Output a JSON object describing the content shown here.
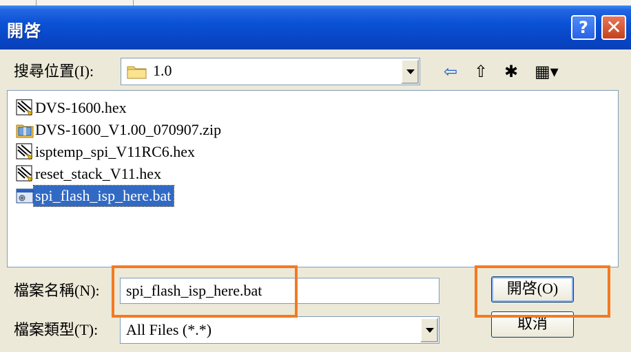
{
  "window": {
    "title": "開啓"
  },
  "titlebar": {
    "help_icon": "?",
    "close_icon": "✕"
  },
  "lookin": {
    "label": "搜尋位置(I):",
    "value": "1.0"
  },
  "toolbar": {
    "back_icon": "⇦",
    "up_icon": "⇧",
    "new_folder_icon": "✱",
    "view_icon": "▦▾"
  },
  "files": [
    {
      "name": "DVS-1600.hex",
      "icon": "hex-file-icon"
    },
    {
      "name": "DVS-1600_V1.00_070907.zip",
      "icon": "zip-file-icon"
    },
    {
      "name": "isptemp_spi_V11RC6.hex",
      "icon": "hex-file-icon"
    },
    {
      "name": "reset_stack_V11.hex",
      "icon": "hex-file-icon"
    },
    {
      "name": "spi_flash_isp_here.bat",
      "icon": "bat-file-icon",
      "selected": true
    }
  ],
  "filename": {
    "label": "檔案名稱(N):",
    "value": "spi_flash_isp_here.bat"
  },
  "filetype": {
    "label": "檔案類型(T):",
    "value": "All Files (*.*)"
  },
  "buttons": {
    "open": "開啓(O)",
    "cancel": "取消"
  },
  "colors": {
    "highlight": "#f47a20",
    "titlebar": "#0a52d6",
    "selection": "#316ac5"
  }
}
